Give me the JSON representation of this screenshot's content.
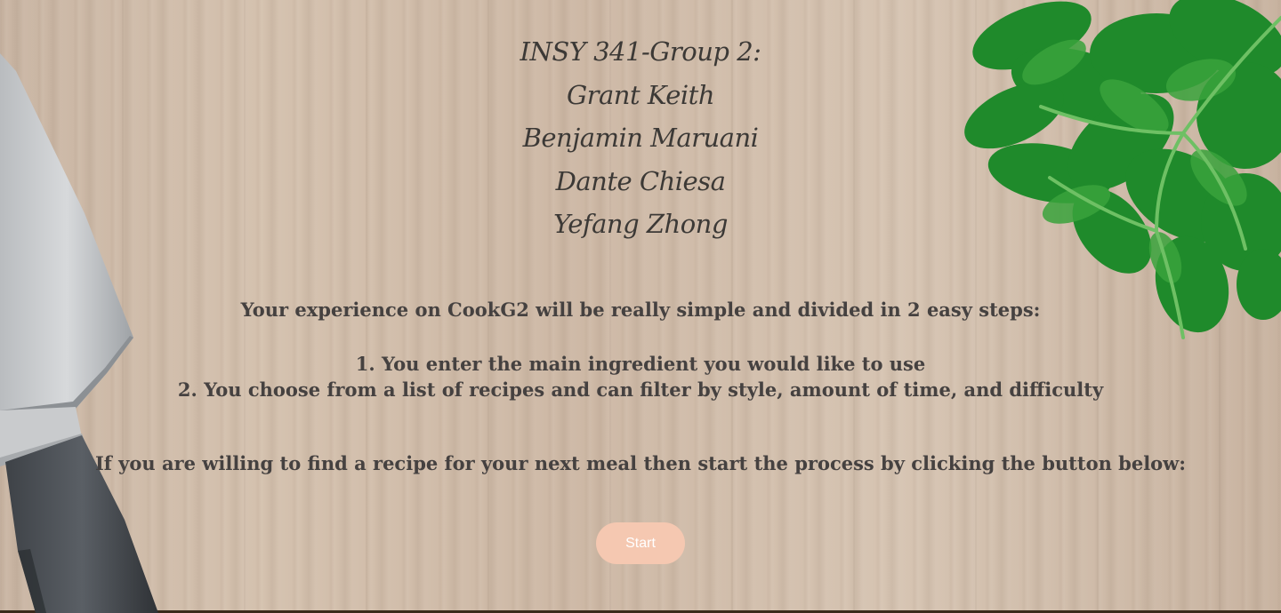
{
  "credits": {
    "group": "INSY 341-Group 2:",
    "members": [
      "Grant Keith",
      "Benjamin Maruani",
      "Dante Chiesa",
      "Yefang Zhong"
    ]
  },
  "intro": "Your experience on CookG2 will be really simple and divided in 2 easy steps:",
  "steps": [
    "1. You enter the main ingredient you would like to use",
    "2. You choose from a list of recipes and can filter by style, amount of time, and difficulty"
  ],
  "cta": "If you are willing to find a recipe for your next meal then start the process by clicking the button below:",
  "start_button": "Start",
  "colors": {
    "button_bg": "#f5c8b1",
    "button_text": "#ffffff",
    "text": "#3c3936",
    "wood": "#d0bca9"
  },
  "decor": {
    "knife": "knife-icon",
    "parsley": "parsley-icon"
  }
}
